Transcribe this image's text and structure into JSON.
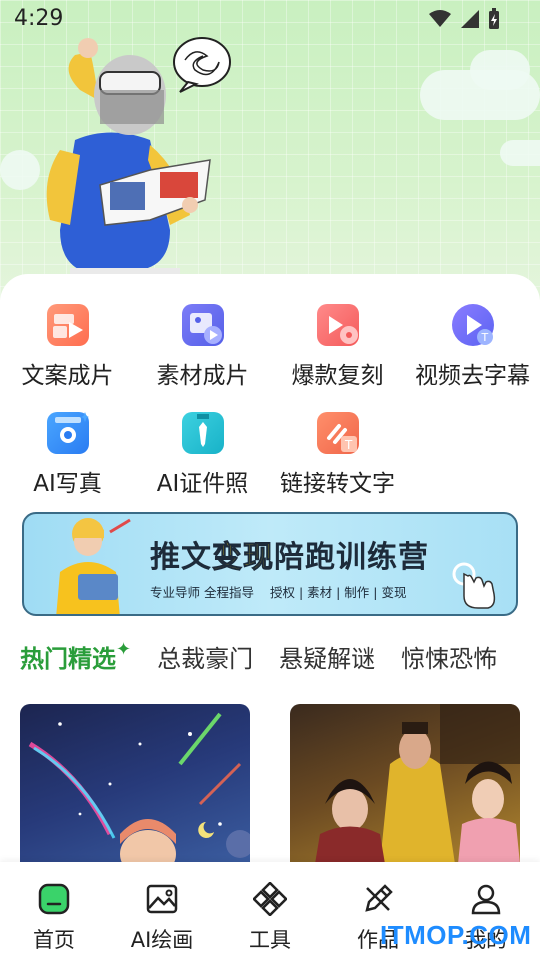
{
  "status": {
    "time": "4:29",
    "icons": [
      "wifi-icon",
      "signal-icon",
      "battery-icon"
    ]
  },
  "functions": [
    {
      "label": "文案成片",
      "icon": "text-video-icon"
    },
    {
      "label": "素材成片",
      "icon": "material-video-icon"
    },
    {
      "label": "爆款复刻",
      "icon": "hit-replicate-icon"
    },
    {
      "label": "视频去字幕",
      "icon": "remove-subtitle-icon"
    },
    {
      "label": "AI写真",
      "icon": "camera-icon"
    },
    {
      "label": "AI证件照",
      "icon": "id-photo-icon"
    },
    {
      "label": "链接转文字",
      "icon": "link-to-text-icon"
    }
  ],
  "banner": {
    "title_part1": "推文",
    "title_highlight": "变现",
    "title_part2": "陪跑训练营",
    "subtitle_left": "专业导师 全程指导",
    "subtitle_right": "授权 | 素材 | 制作 | 变现"
  },
  "tabs": [
    {
      "label": "热门精选",
      "active": true
    },
    {
      "label": "总裁豪门",
      "active": false
    },
    {
      "label": "悬疑解谜",
      "active": false
    },
    {
      "label": "惊悚恐怖",
      "active": false
    }
  ],
  "nav": [
    {
      "label": "首页",
      "icon": "home-icon",
      "active": true
    },
    {
      "label": "AI绘画",
      "icon": "image-icon",
      "active": false
    },
    {
      "label": "工具",
      "icon": "tools-icon",
      "active": false
    },
    {
      "label": "作品",
      "icon": "pencil-ruler-icon",
      "active": false
    },
    {
      "label": "我的",
      "icon": "user-icon",
      "active": false
    }
  ],
  "watermark": "ITMOP.COM",
  "colors": {
    "accent_green": "#2a9d3a",
    "hero_bg": "#d7f3cd"
  }
}
